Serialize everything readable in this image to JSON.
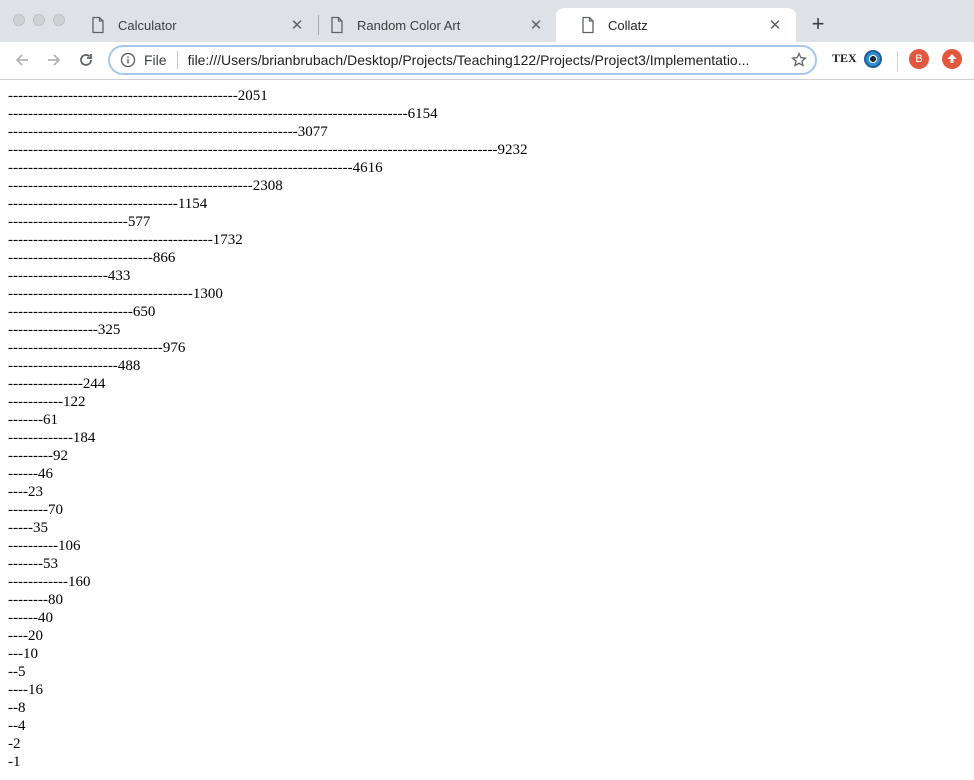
{
  "tabs": [
    {
      "label": "Calculator",
      "active": false
    },
    {
      "label": "Random Color Art",
      "active": false
    },
    {
      "label": "Collatz",
      "active": true
    }
  ],
  "toolbar": {
    "file_chip": "File",
    "url": "file:///Users/brianbrubach/Desktop/Projects/Teaching122/Projects/Project3/Implementatio...",
    "tex_ext_label": "TEX",
    "avatar_letter": "B"
  },
  "page": {
    "lines": [
      "----------------------------------------------2051",
      "--------------------------------------------------------------------------------6154",
      "----------------------------------------------------------3077",
      "--------------------------------------------------------------------------------------------------9232",
      "---------------------------------------------------------------------4616",
      "-------------------------------------------------2308",
      "----------------------------------1154",
      "------------------------577",
      "-----------------------------------------1732",
      "-----------------------------866",
      "--------------------433",
      "-------------------------------------1300",
      "-------------------------650",
      "------------------325",
      "-------------------------------976",
      "----------------------488",
      "---------------244",
      "-----------122",
      "-------61",
      "-------------184",
      "---------92",
      "------46",
      "----23",
      "--------70",
      "-----35",
      "----------106",
      "-------53",
      "------------160",
      "--------80",
      "------40",
      "----20",
      "---10",
      "--5",
      "----16",
      "--8",
      "--4",
      "-2",
      "-1"
    ]
  }
}
